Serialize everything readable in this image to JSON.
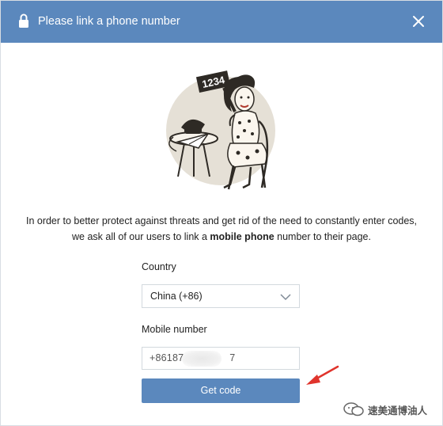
{
  "dialog": {
    "title": "Please link a phone number",
    "lock_icon": "lock-icon",
    "close_icon": "close-icon"
  },
  "illustration": {
    "sign_text": "1234"
  },
  "description": {
    "line1": "In order to better protect against threats and get rid of the need to constantly enter codes,",
    "line2_before": "we ask all of our users to link a ",
    "line2_bold": "mobile phone",
    "line2_after": " number to their page."
  },
  "form": {
    "country_label": "Country",
    "country_value": "China (+86)",
    "mobile_label": "Mobile number",
    "mobile_value_prefix": "+86187",
    "mobile_value_suffix": "7",
    "submit_label": "Get code"
  },
  "watermark": {
    "text": "速美通博油人"
  },
  "colors": {
    "header": "#5b88bd",
    "button": "#5b88bd",
    "arrow": "#e0342c"
  }
}
